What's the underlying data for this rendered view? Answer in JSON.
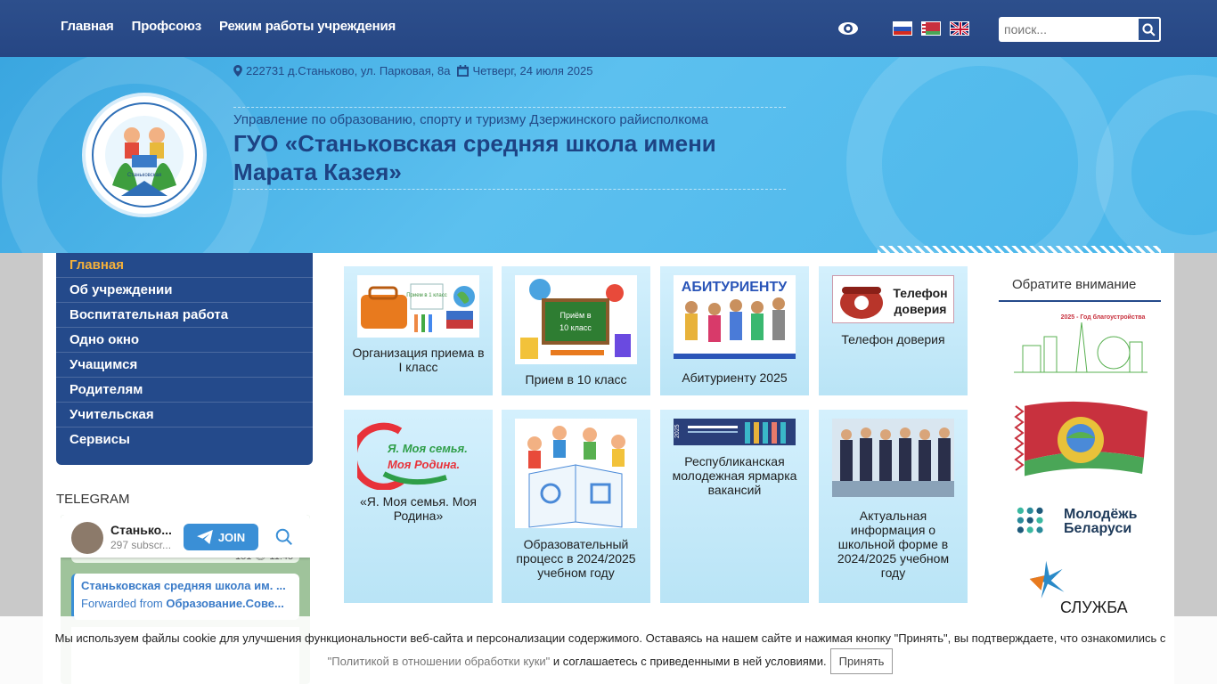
{
  "topnav": {
    "items": [
      "Главная",
      "Профсоюз",
      "Режим работы учреждения"
    ]
  },
  "toolbar": {
    "eye_icon": "eye-icon",
    "flags": [
      "ru-flag",
      "by-flag",
      "uk-flag"
    ],
    "search_placeholder": "поиск..."
  },
  "header": {
    "address": "222731 д.Станьково, ул. Парковая, 8а",
    "date": "Четверг, 24 июля 2025",
    "department": "Управление по образованию, спорту и туризму Дзержинского райисполкома",
    "school_name": "ГУО «Станьковская средняя школа имени Марата Казея»"
  },
  "sidebar": {
    "items": [
      {
        "label": "Главная"
      },
      {
        "label": "Об учреждении"
      },
      {
        "label": "Воспитательная работа"
      },
      {
        "label": "Одно окно"
      },
      {
        "label": "Учащимся"
      },
      {
        "label": "Родителям"
      },
      {
        "label": "Учительская"
      },
      {
        "label": "Сервисы"
      }
    ]
  },
  "telegram": {
    "title": "TELEGRAM",
    "channel": "Станько...",
    "subscribers": "297 subscr...",
    "join": "JOIN",
    "views_time": "151 👁 11:45",
    "msg_line1": "Станьковская средняя школа им. ...",
    "msg_line2_prefix": "Forwarded from ",
    "msg_line2_source": "Образование.Сове..."
  },
  "cards": [
    {
      "caption": "Организация приема в I класс",
      "img_text": "Прием в 1 класс"
    },
    {
      "caption": "Прием в 10 класс",
      "img_text": "Приём в 10 класс"
    },
    {
      "caption": "Абитуриенту 2025",
      "img_text": "АБИТУРИЕНТУ"
    },
    {
      "caption": "Телефон доверия",
      "img_text": "Телефон доверия"
    },
    {
      "caption": "«Я. Моя семья. Моя Родина»",
      "img_text": "Я. Моя семья. Моя Родина."
    },
    {
      "caption": "Образовательный процесс в 2024/2025 учебном году",
      "img_text": ""
    },
    {
      "caption": "Республиканская молодежная ярмарка вакансий",
      "img_text": "2025"
    },
    {
      "caption": "Актуальная информация о школьной форме в 2024/2025 учебном году",
      "img_text": ""
    }
  ],
  "right": {
    "attention": "Обратите внимание",
    "banner1": "2025 - Год благоустройства",
    "banner3": "Молодёжь Беларуси",
    "banner4": "СЛУЖБА"
  },
  "cookie": {
    "text": "Мы используем файлы cookie для улучшения функциональности веб-сайта и персонализации содержимого. Оставаясь на нашем сайте и нажимая кнопку \"Принять\", вы подтверждаете, что ознакомились с ",
    "link": "\"Политикой в отношении обработки куки\"",
    "text2": " и соглашаетесь с приведенными в ней условиями.",
    "button": "Принять"
  },
  "colors": {
    "topbar": "#264684",
    "header_blue": "#4ab6ea",
    "menu_blue": "#244a8b",
    "active_menu": "#f4b03a",
    "card_bg": "#c6eafa"
  }
}
